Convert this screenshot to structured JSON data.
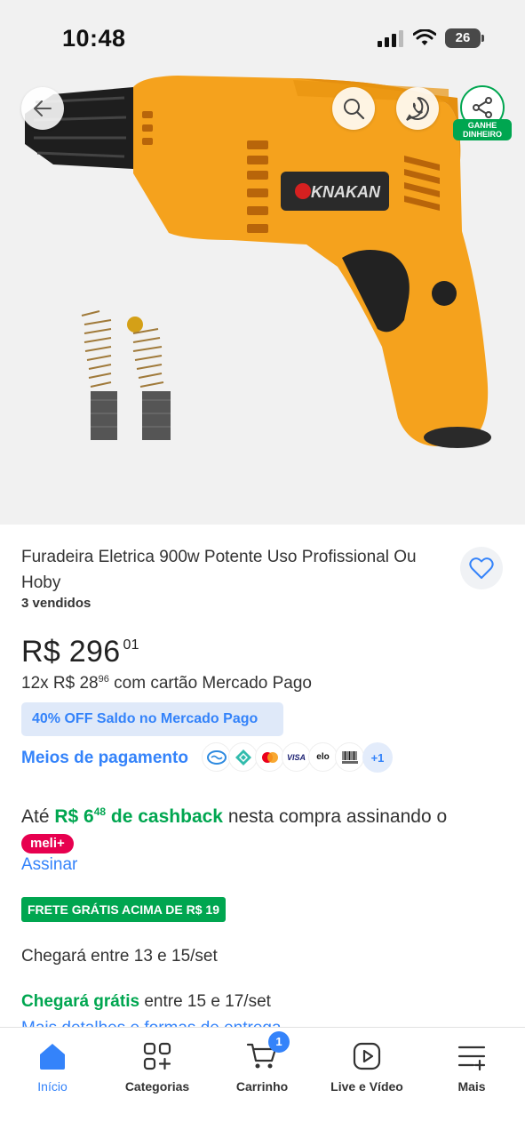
{
  "status_bar": {
    "time": "10:48",
    "battery": "26"
  },
  "hero": {
    "brand_text": "KNAKAN",
    "share_badge": "GANHE DINHEIRO"
  },
  "product": {
    "title": "Furadeira Eletrica 900w Potente Uso Profissional Ou Hoby",
    "sold": "3 vendidos",
    "price_main": "R$ 296",
    "price_cents": "01",
    "installment_prefix": "12x R$ 28",
    "installment_cents": "96",
    "installment_suffix": " com cartão Mercado Pago",
    "discount": "40% OFF Saldo no Mercado Pago",
    "payment_link": "Meios de pagamento",
    "payment_more": "+1"
  },
  "cashback": {
    "prefix": "Até ",
    "amount_main": "R$ 6",
    "amount_cents": "48",
    "amount_suffix": " de cashback",
    "middle": " nesta compra assinando o ",
    "badge": "meli+",
    "subscribe": "Assinar"
  },
  "shipping": {
    "free_badge": "FRETE GRÁTIS ACIMA DE R$ 19",
    "arrival": "Chegará entre 13 e 15/set",
    "free_label": "Chegará grátis",
    "free_dates": " entre 15 e 17/set",
    "more_details": "Mais detalhes e formas de entrega"
  },
  "bottom_nav": {
    "items": [
      {
        "label": "Início"
      },
      {
        "label": "Categorias"
      },
      {
        "label": "Carrinho",
        "badge": "1"
      },
      {
        "label": "Live e Vídeo"
      },
      {
        "label": "Mais"
      }
    ]
  },
  "colors": {
    "accent": "#3483fa",
    "green": "#00a650",
    "drill_body": "#f5a21d",
    "meli_plus": "#e7004f"
  }
}
